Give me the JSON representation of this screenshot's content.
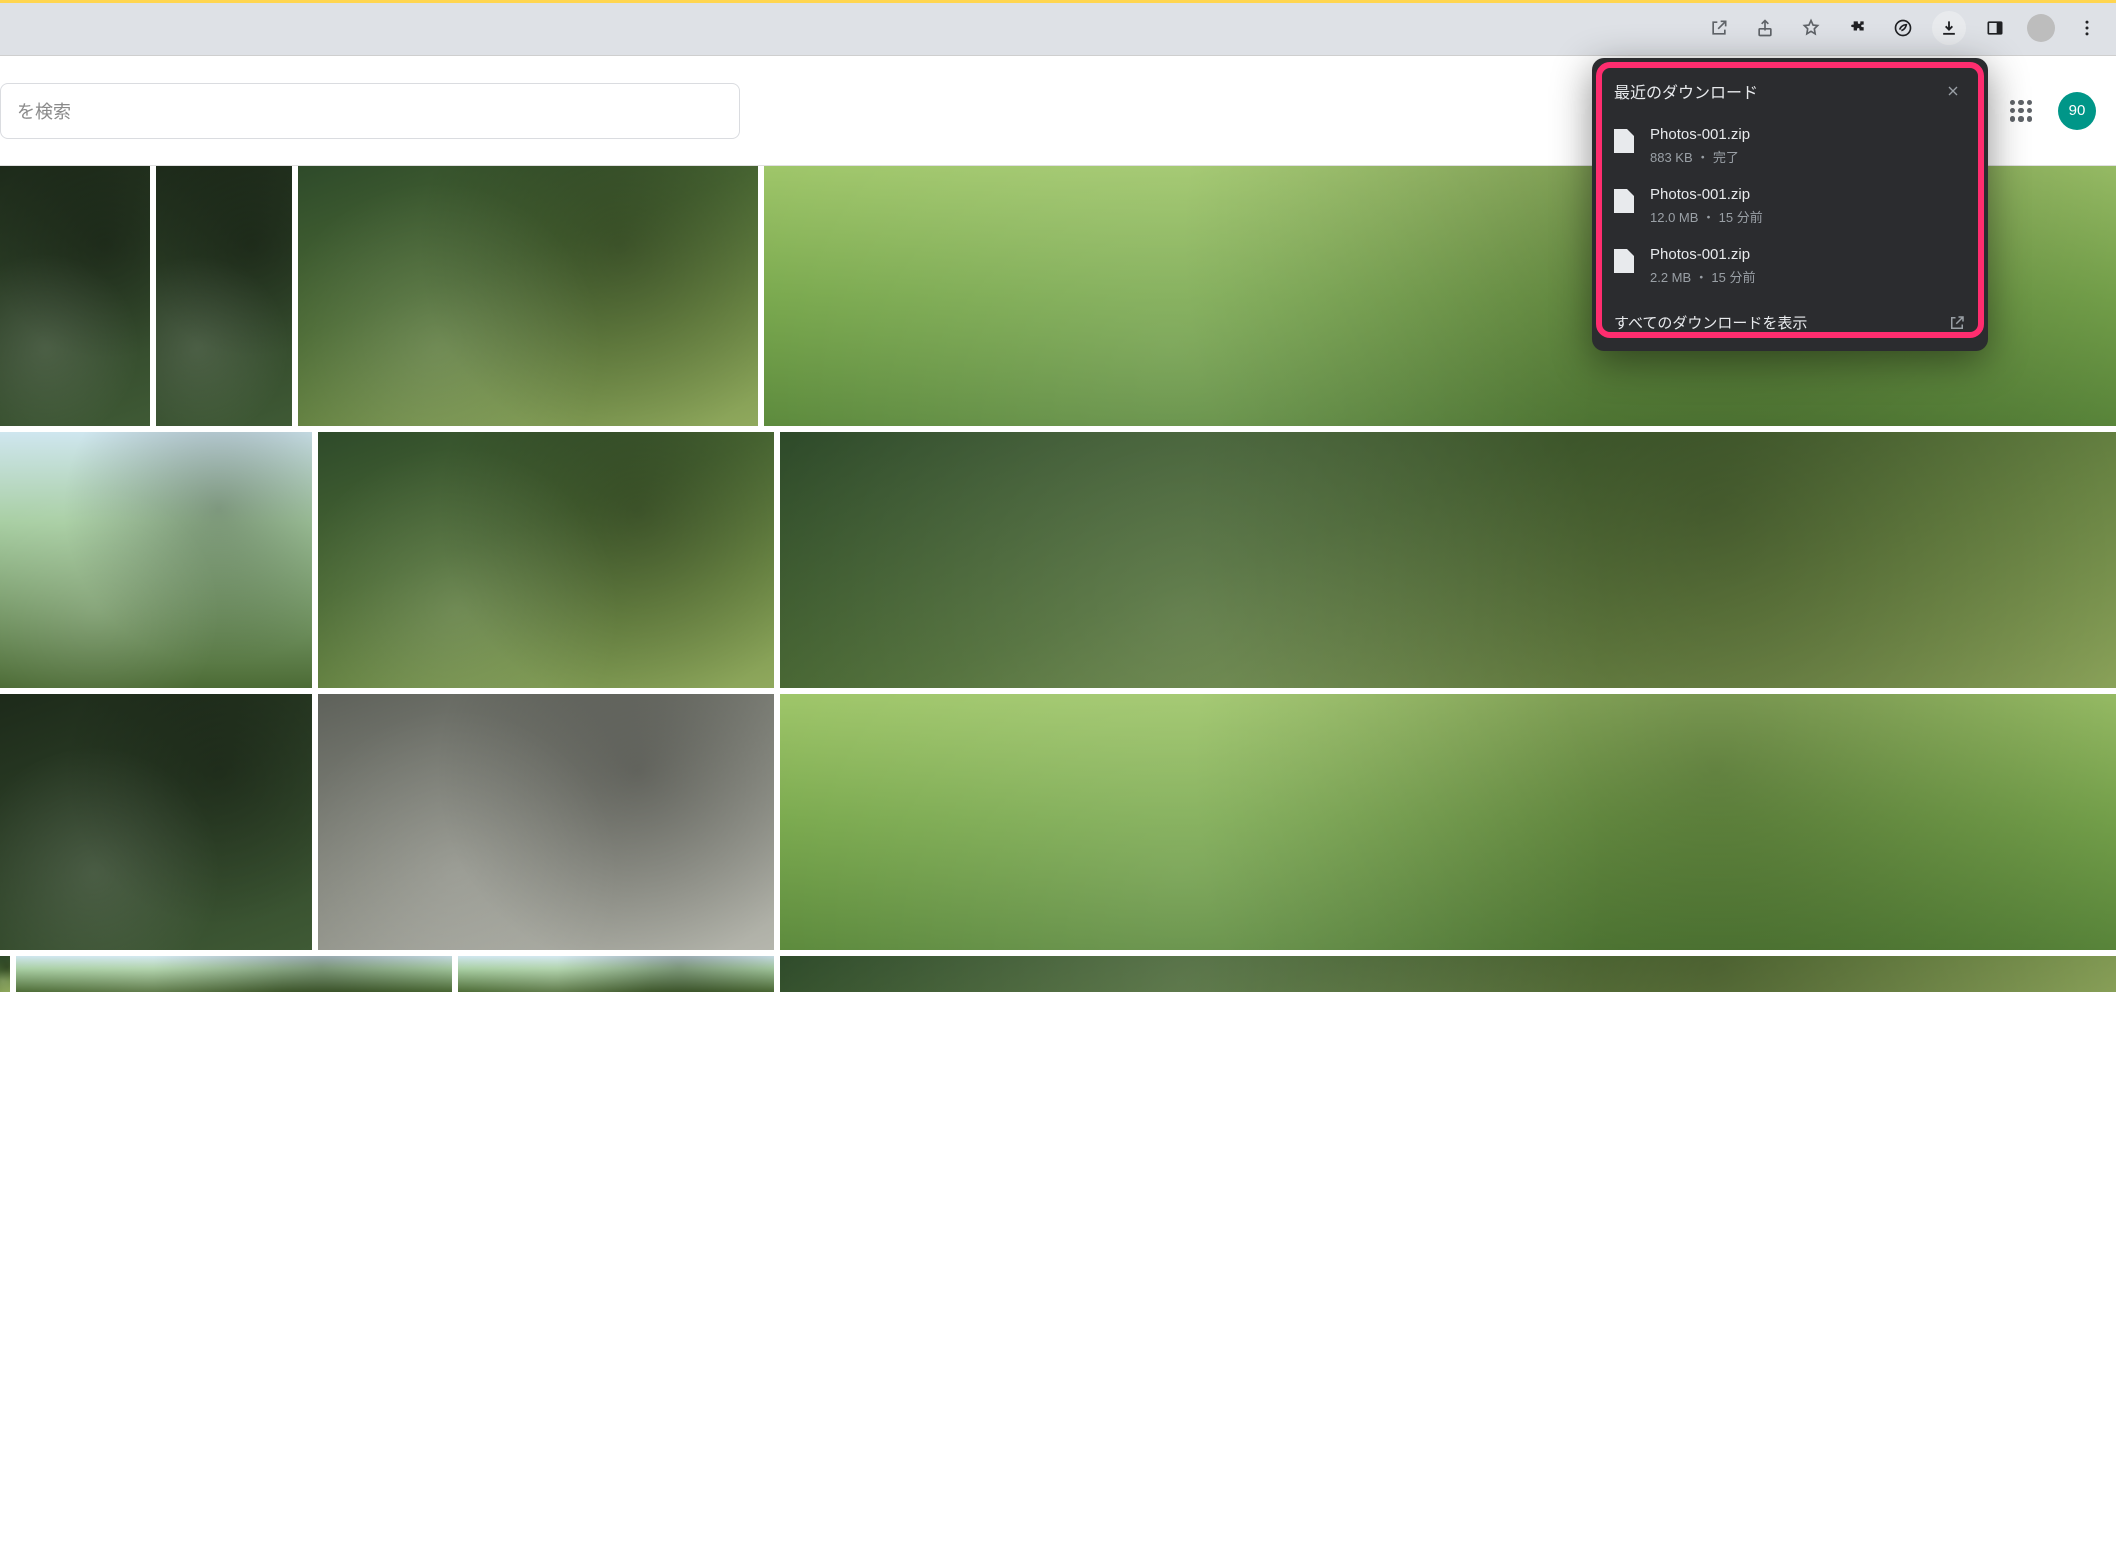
{
  "toolbar": {
    "icons": {
      "open_external": "open-in-new-icon",
      "share": "share-icon",
      "star": "star-icon",
      "extensions": "puzzle-icon",
      "leaf": "leaf-icon",
      "download": "download-icon",
      "panel": "side-panel-icon",
      "profile": "profile-icon",
      "menu": "kebab-menu-icon"
    }
  },
  "header": {
    "search_placeholder": "を検索",
    "account_label": "90"
  },
  "downloads": {
    "title": "最近のダウンロード",
    "items": [
      {
        "name": "Photos-001.zip",
        "meta": "883 KB ・ 完了"
      },
      {
        "name": "Photos-001.zip",
        "meta": "12.0 MB ・ 15 分前"
      },
      {
        "name": "Photos-001.zip",
        "meta": "2.2 MB ・ 15 分前"
      }
    ],
    "footer": "すべてのダウンロードを表示"
  }
}
